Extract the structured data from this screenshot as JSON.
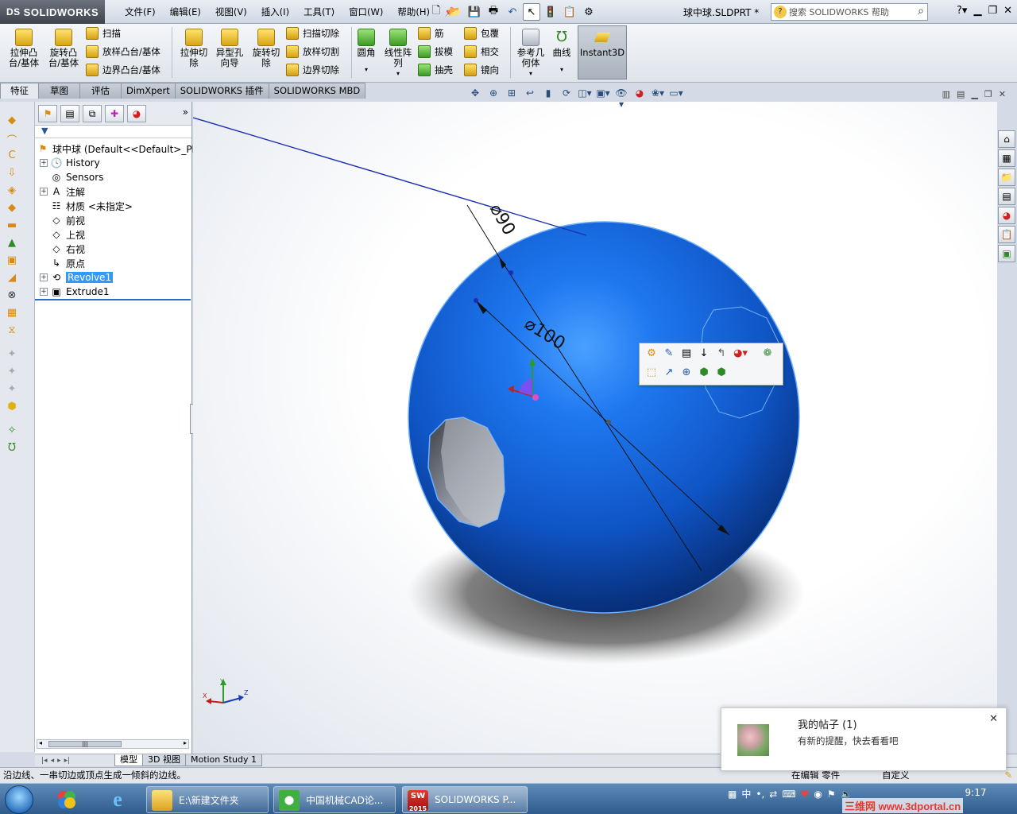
{
  "app": {
    "logo": "SOLIDWORKS",
    "logo_mark": "DS",
    "doc_title": "球中球.SLDPRT *"
  },
  "menu": [
    "文件(F)",
    "编辑(E)",
    "视图(V)",
    "插入(I)",
    "工具(T)",
    "窗口(W)",
    "帮助(H)"
  ],
  "help_search": {
    "placeholder": "搜索 SOLIDWORKS 帮助"
  },
  "commands": {
    "extrude_boss": "拉伸凸\n台/基体",
    "revolve_boss": "旋转凸\n台/基体",
    "sweep": "扫描",
    "loft_boss": "放样凸台/基体",
    "boundary_boss": "边界凸台/基体",
    "extrude_cut": "拉伸切\n除",
    "hole_wizard": "异型孔\n向导",
    "revolve_cut": "旋转切\n除",
    "sweep_cut": "扫描切除",
    "loft_cut": "放样切割",
    "boundary_cut": "边界切除",
    "fillet": "圆角",
    "linear_pattern": "线性阵\n列",
    "rib": "筋",
    "draft": "拔模",
    "shell": "抽壳",
    "wrap": "包覆",
    "intersect": "相交",
    "mirror": "镜向",
    "ref_geometry": "参考几\n何体",
    "curves": "曲线",
    "instant3d": "Instant3D"
  },
  "tabs": [
    "特征",
    "草图",
    "评估",
    "DimXpert",
    "SOLIDWORKS 插件",
    "SOLIDWORKS MBD"
  ],
  "tree": {
    "root": "球中球  (Default<<Default>_Ph",
    "items": [
      {
        "label": "History",
        "expandable": true,
        "icon": "history-icon"
      },
      {
        "label": "Sensors",
        "expandable": false,
        "icon": "sensor-icon"
      },
      {
        "label": "注解",
        "expandable": true,
        "icon": "annotation-icon"
      },
      {
        "label": "材质 <未指定>",
        "expandable": false,
        "icon": "material-icon"
      },
      {
        "label": "前视",
        "expandable": false,
        "icon": "plane-icon"
      },
      {
        "label": "上视",
        "expandable": false,
        "icon": "plane-icon"
      },
      {
        "label": "右视",
        "expandable": false,
        "icon": "plane-icon"
      },
      {
        "label": "原点",
        "expandable": false,
        "icon": "origin-icon"
      },
      {
        "label": "Revolve1",
        "expandable": true,
        "icon": "revolve-icon",
        "selected": true
      },
      {
        "label": "Extrude1",
        "expandable": true,
        "icon": "extrude-icon"
      }
    ]
  },
  "dimensions": {
    "d1": "⌀90",
    "d2": "⌀100"
  },
  "bottom_tabs": [
    "模型",
    "3D 视图",
    "Motion Study 1"
  ],
  "status": {
    "message": "沿边线、一串切边或顶点生成一倾斜的边线。",
    "mode": "在编辑 零件",
    "custom": "自定义"
  },
  "notification": {
    "title": "我的帖子 (1)",
    "body": "有新的提醒，快去看看吧"
  },
  "taskbar": {
    "windows": [
      "E:\\新建文件夹",
      "中国机械CAD论...",
      "SOLIDWORKS P..."
    ],
    "clock": "9:17",
    "tray_lang": "中",
    "sw_year": "2015"
  },
  "watermark": "三维网 www.3dportal.cn",
  "colors": {
    "sphere": "#1a5fd6",
    "accent": "#3399ff"
  }
}
